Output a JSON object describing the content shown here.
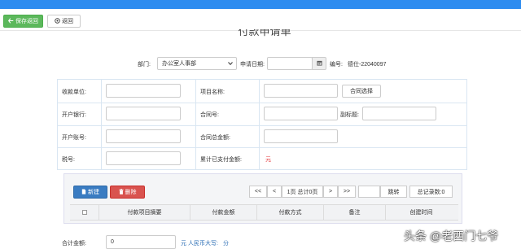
{
  "toolbar": {
    "save_label": "保存返回",
    "back_label": "返回"
  },
  "page": {
    "title": "付款申请单"
  },
  "header": {
    "dept_label": "部门:",
    "dept_value": "办公室人事部",
    "date_label": "申请日期:",
    "date_value": "",
    "code_label": "编号:",
    "code_value": "德仕-22040097"
  },
  "form": {
    "payee_label": "收款单位:",
    "project_label": "项目名称:",
    "contract_select_label": "合同选择",
    "bank_label": "开户银行:",
    "contract_no_label": "合同号:",
    "subtitle_label": "副标题:",
    "account_label": "开户账号:",
    "contract_total_label": "合同总金额:",
    "tax_label": "税号:",
    "paid_total_label": "累计已支付金额:",
    "paid_total_value": "元"
  },
  "grid": {
    "new_label": "新建",
    "delete_label": "删除",
    "pager": {
      "first": "<<",
      "prev": "<",
      "info": "1页 总计0页",
      "next": ">",
      "last": ">>",
      "jump_value": "",
      "jump_label": "跳转",
      "count_label": "总记录数:0"
    },
    "columns": [
      "付款项目摘要",
      "付款金额",
      "付款方式",
      "备注",
      "创建时间"
    ]
  },
  "footer": {
    "total_label": "合计金额:",
    "total_value": "0",
    "rmb_label": "元 人民币大写:",
    "rmb_value": "分"
  },
  "watermark": "头条 @老西门七爷",
  "colors": {
    "topbar": "#2d8cf0",
    "save": "#5cb85c",
    "new": "#3a7cc2",
    "delete": "#d9534f",
    "required": "#e4393c"
  }
}
